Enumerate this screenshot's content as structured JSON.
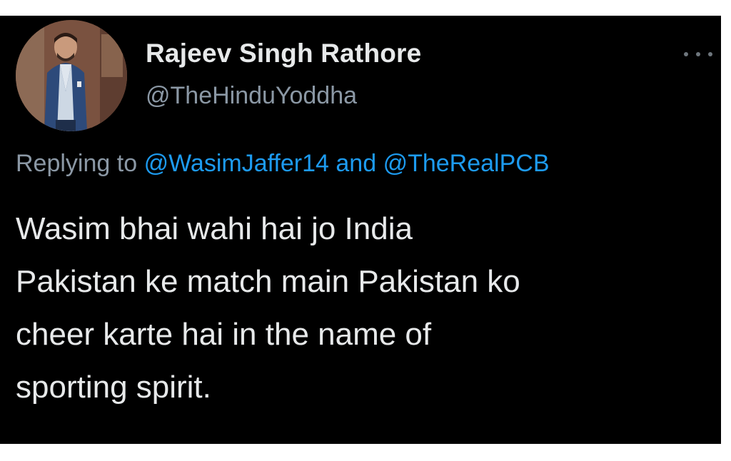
{
  "tweet": {
    "display_name": "Rajeev Singh Rathore",
    "handle": "@TheHinduYoddha",
    "reply_prefix": "Replying to",
    "reply_mention_1": "@WasimJaffer14",
    "reply_conjunction": "and",
    "reply_mention_2": "@TheRealPCB",
    "body_lines": [
      "Wasim bhai wahi hai jo India",
      "Pakistan ke match main Pakistan ko",
      "cheer karte hai in the name of",
      "sporting spirit."
    ]
  },
  "icons": {
    "more": "more-horizontal-icon"
  },
  "colors": {
    "background": "#000000",
    "text_primary": "#e7e9ea",
    "text_secondary": "#8b98a5",
    "link": "#1d9bf0"
  }
}
